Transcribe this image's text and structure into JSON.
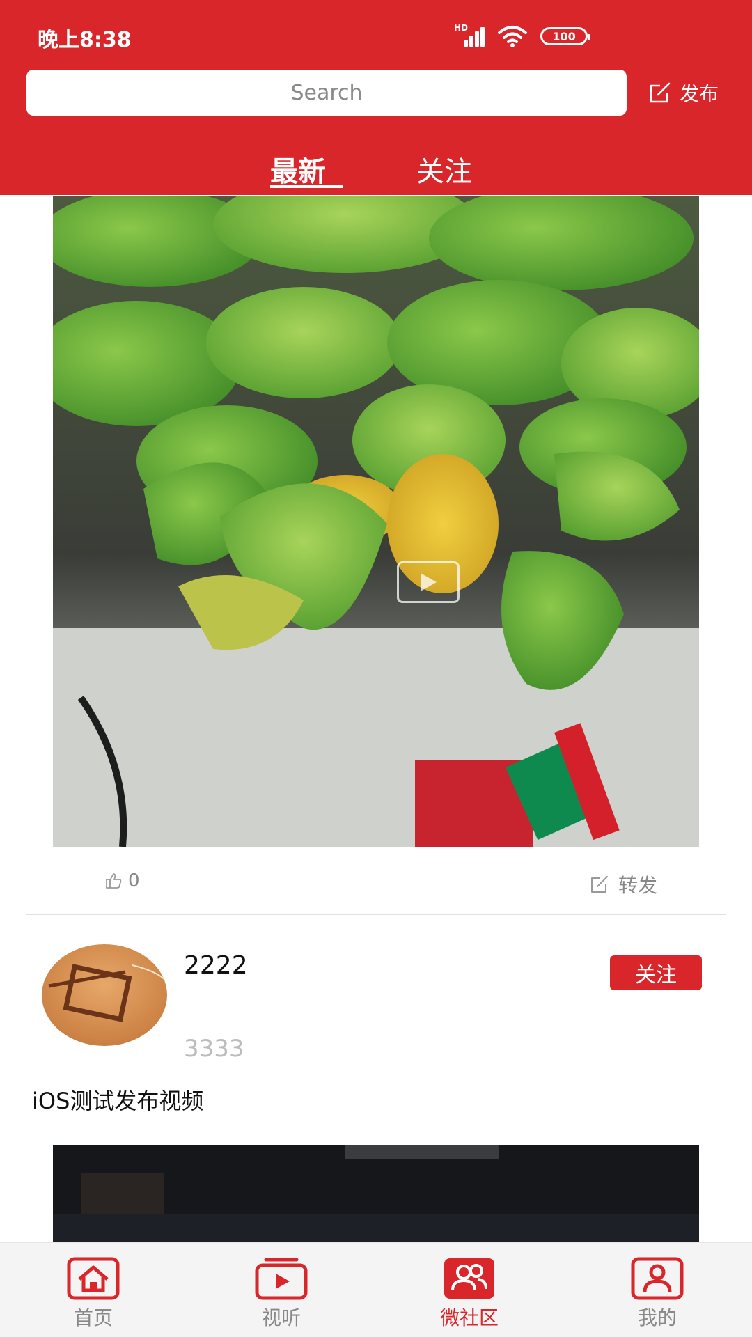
{
  "status_bar": {
    "time": "晚上8:38",
    "network": "HD",
    "battery": "100"
  },
  "header": {
    "search_placeholder": "Search",
    "publish_label": "发布"
  },
  "tabs": [
    {
      "label": "最新",
      "active": true
    },
    {
      "label": "关注",
      "active": false
    }
  ],
  "feed": {
    "post_1": {
      "media_type": "video",
      "like_count": "0",
      "share_label": "转发"
    },
    "post_2": {
      "username": "2222",
      "subline": "3333",
      "follow_label": "关注",
      "text": "iOS测试发布视频",
      "media_type": "video"
    }
  },
  "bottom_nav": [
    {
      "label": "首页",
      "icon": "home-icon",
      "active": false
    },
    {
      "label": "视听",
      "icon": "video-icon",
      "active": false
    },
    {
      "label": "微社区",
      "icon": "community-icon",
      "active": true
    },
    {
      "label": "我的",
      "icon": "profile-icon",
      "active": false
    }
  ],
  "colors": {
    "brand_red": "#d9262b",
    "muted_gray": "#888888"
  }
}
